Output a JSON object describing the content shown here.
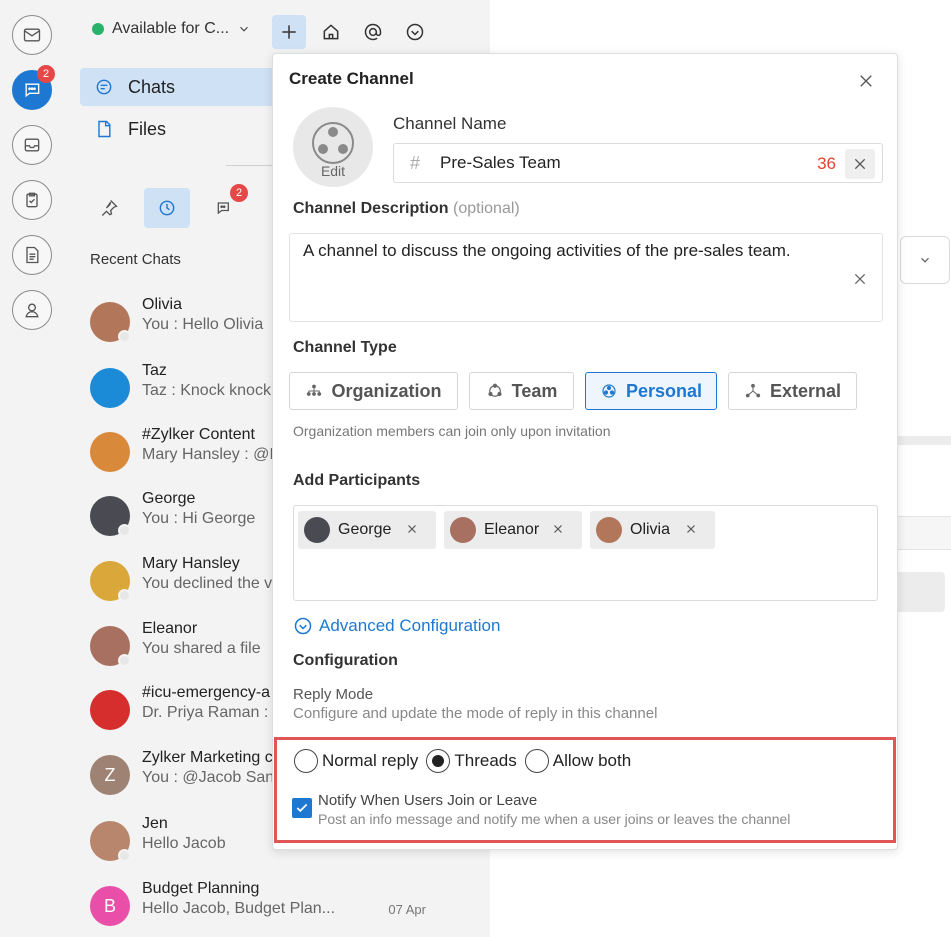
{
  "rail": {
    "chat_badge": "2",
    "icons": [
      "mail-icon",
      "chat-icon",
      "inbox-icon",
      "clipboard-icon",
      "document-icon",
      "person-icon"
    ]
  },
  "panel": {
    "status": "Available for C...",
    "nav": {
      "chats": "Chats",
      "files": "Files"
    },
    "tab_badge": "2",
    "recent_title": "Recent Chats",
    "chats": [
      {
        "name": "Olivia",
        "msg": "You : Hello Olivia",
        "color": "#b2765a"
      },
      {
        "name": "Taz",
        "msg": "Taz : Knock knock",
        "color": "#1b8bd8"
      },
      {
        "name": "#Zylker Content",
        "msg": "Mary Hansley : @I",
        "color": "#d9893a"
      },
      {
        "name": "George",
        "msg": "You : Hi George",
        "color": "#4a4a52"
      },
      {
        "name": "Mary Hansley",
        "msg": "You declined the v",
        "color": "#d9a73a"
      },
      {
        "name": "Eleanor",
        "msg": "You shared a file",
        "color": "#a77060"
      },
      {
        "name": "#icu-emergency-a",
        "msg": "Dr. Priya Raman :",
        "color": "#d62d2d"
      },
      {
        "name": "Zylker Marketing c",
        "msg": "You : @Jacob San",
        "color": "#9e8273",
        "initial": "Z"
      },
      {
        "name": "Jen",
        "msg": "Hello Jacob",
        "color": "#b8866c"
      },
      {
        "name": "Budget Planning",
        "msg": "Hello Jacob, Budget Plan...",
        "time": "07 Apr",
        "color": "#e94fa8",
        "initial": "B"
      }
    ]
  },
  "modal": {
    "title": "Create Channel",
    "avatar_edit": "Edit",
    "name_label": "Channel Name",
    "name_value": "Pre-Sales Team",
    "char_count": "36",
    "desc_label": "Channel Description",
    "desc_optional": "(optional)",
    "desc_value": "A channel to discuss the ongoing activities of the pre-sales team.",
    "type_label": "Channel Type",
    "types": [
      "Organization",
      "Team",
      "Personal",
      "External"
    ],
    "selected_type": "Personal",
    "type_hint": "Organization members can join only upon invitation",
    "participants_label": "Add Participants",
    "participants": [
      "George",
      "Eleanor",
      "Olivia"
    ],
    "advanced": "Advanced Configuration",
    "config_label": "Configuration",
    "reply_mode": "Reply Mode",
    "reply_desc": "Configure and update the mode of reply in this channel",
    "reply_options": [
      "Normal reply",
      "Threads",
      "Allow both"
    ],
    "reply_selected": "Threads",
    "notify_title": "Notify When Users Join or Leave",
    "notify_desc": "Post an info message and notify me when a user joins or leaves the channel",
    "notify_checked": true
  }
}
